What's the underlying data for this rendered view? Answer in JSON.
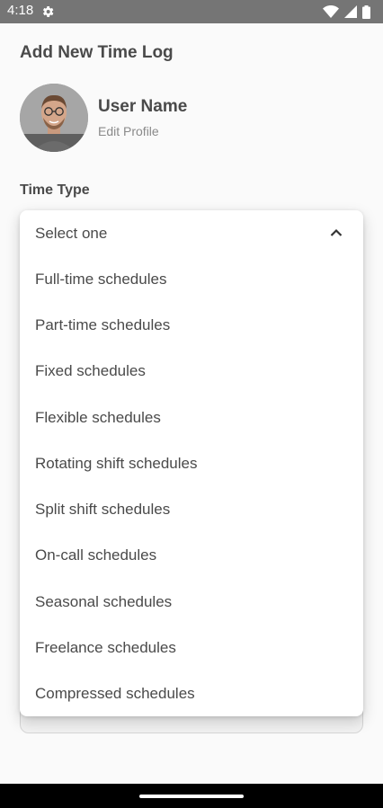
{
  "status_bar": {
    "time": "4:18",
    "icons": [
      "settings-icon",
      "wifi-icon",
      "signal-icon",
      "battery-icon"
    ]
  },
  "screen": {
    "title": "Add New Time Log"
  },
  "profile": {
    "name": "User Name",
    "edit_label": "Edit Profile"
  },
  "time_type": {
    "label": "Time Type",
    "dropdown": {
      "selected": "Select one",
      "expanded": true,
      "options": [
        "Full-time schedules",
        "Part-time schedules",
        "Fixed schedules",
        "Flexible schedules",
        "Rotating shift schedules",
        "Split shift schedules",
        "On-call schedules",
        "Seasonal schedules",
        "Freelance schedules",
        "Compressed schedules"
      ]
    }
  },
  "colors": {
    "status_bar": "#757575",
    "background": "#fafafa",
    "text": "#4a4a4a",
    "muted_text": "#8a8a8a",
    "nav_bar": "#000000"
  }
}
